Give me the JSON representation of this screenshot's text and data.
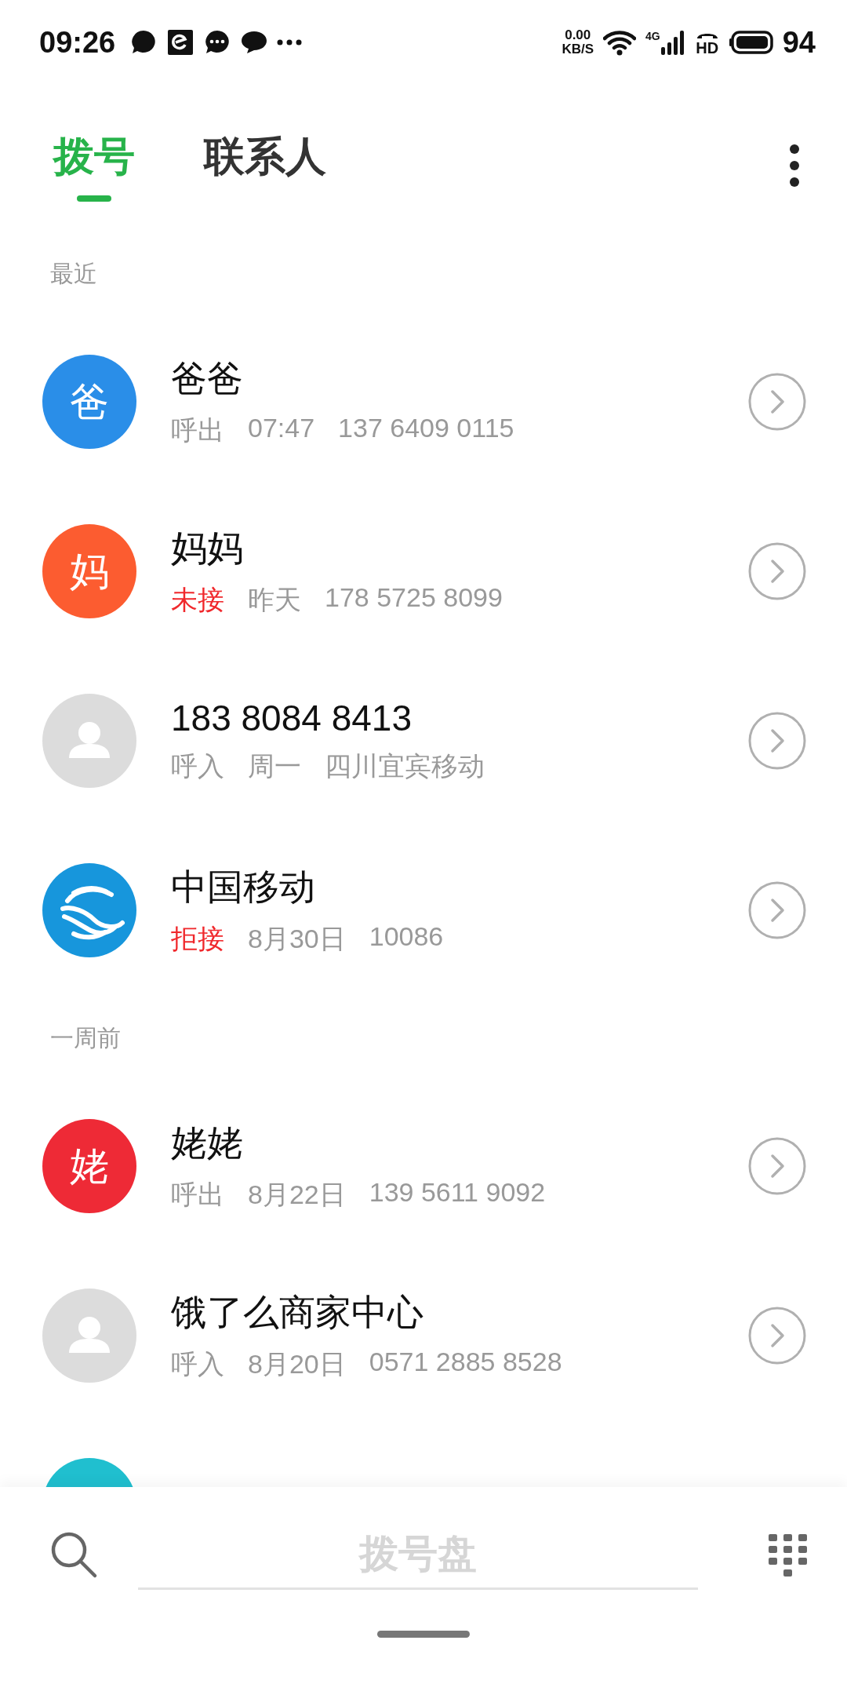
{
  "status_bar": {
    "time": "09:26",
    "net_speed": "0.00",
    "net_unit": "KB/S",
    "network": "4G",
    "hd": "HD",
    "battery": "94"
  },
  "tabs": [
    {
      "label": "拨号",
      "selected": true
    },
    {
      "label": "联系人",
      "selected": false
    }
  ],
  "sections": [
    {
      "title": "最近",
      "calls": [
        {
          "name": "爸爸",
          "avatar": {
            "kind": "letter",
            "char": "爸",
            "color": "#2a8ee8"
          },
          "type": "呼出",
          "alert": false,
          "time": "07:47",
          "detail": "137 6409 0115"
        },
        {
          "name": "妈妈",
          "avatar": {
            "kind": "letter",
            "char": "妈",
            "color": "#fc5c30"
          },
          "type": "未接",
          "alert": true,
          "time": "昨天",
          "detail": "178 5725 8099"
        },
        {
          "name": "183 8084 8413",
          "avatar": {
            "kind": "person",
            "color": "#dcdcdc"
          },
          "type": "呼入",
          "alert": false,
          "time": "周一",
          "detail": "四川宜宾移动"
        },
        {
          "name": "中国移动",
          "avatar": {
            "kind": "logo",
            "color": "#1796dc"
          },
          "type": "拒接",
          "alert": true,
          "time": "8月30日",
          "detail": "10086"
        }
      ]
    },
    {
      "title": "一周前",
      "calls": [
        {
          "name": "姥姥",
          "avatar": {
            "kind": "letter",
            "char": "姥",
            "color": "#ee2a36"
          },
          "type": "呼出",
          "alert": false,
          "time": "8月22日",
          "detail": "139 5611 9092"
        },
        {
          "name": "饿了么商家中心",
          "avatar": {
            "kind": "person",
            "color": "#dcdcdc"
          },
          "type": "呼入",
          "alert": false,
          "time": "8月20日",
          "detail": "0571 2885 8528"
        },
        {
          "avatar": {
            "kind": "letter",
            "color": "#20bfcf"
          }
        }
      ]
    }
  ],
  "dial_field": {
    "placeholder": "拨号盘"
  }
}
